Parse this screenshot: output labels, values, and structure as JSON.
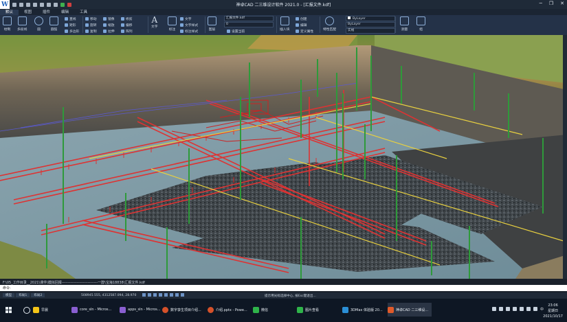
{
  "app": {
    "title": "神卓CAD 二三维设计软件 2021.0 - [汇报文件.kdf]",
    "logo_letter": "W"
  },
  "window_controls": {
    "minimize": "─",
    "maximize": "❐",
    "close": "✕"
  },
  "tabs": [
    "默认",
    "视图",
    "插件",
    "编辑",
    "工具"
  ],
  "active_tab": 0,
  "ribbon": {
    "draw_big": [
      "绘制",
      "多段线",
      "圆",
      "圆弧"
    ],
    "draw_small": [
      "直线",
      "矩形",
      "多边形"
    ],
    "modify": [
      "移动",
      "旋转",
      "复制",
      "镜像",
      "缩放",
      "拉伸",
      "修剪",
      "偏移",
      "阵列"
    ],
    "text_big": "文字",
    "text_big2": "标注",
    "text_small": [
      "文字",
      "文字样式",
      "标注样式"
    ],
    "layer_big": "图层",
    "layer_dropdown": "汇报文件.kdf",
    "layer_dropdown2": "0",
    "layer_set": "设置当前",
    "block_big": "插入块",
    "block_small": [
      "创建",
      "编辑",
      "定义属性"
    ],
    "prop_big": "特性匹配",
    "bylayer1": "ByLayer",
    "bylayer2": "ByLayer",
    "bylayer3": "实线",
    "measure": "测量",
    "group": "组"
  },
  "command": {
    "history": "F:\\05_工作目录__2021\\课件\\模拟回报-----------------------------一醇\\宝海18838\\汇报文件.kdf",
    "prompt": "命令:"
  },
  "status": {
    "tabs": [
      "模型",
      "布局1",
      "布局2"
    ],
    "coords": "508945.555, 4312587.094, 28.970",
    "hint": "提示用光标选择中心, 按Esc键退出..."
  },
  "taskbar": {
    "items": [
      {
        "label": "早晨",
        "color": "#f5c518"
      },
      {
        "label": "core_sln - Micros...",
        "color": "#8a5fd1"
      },
      {
        "label": "apps_sln - Micros...",
        "color": "#8a5fd1"
      },
      {
        "label": "数字孪生项目介绍...",
        "color": "#d5512a"
      },
      {
        "label": "介绍.pptx - Powe...",
        "color": "#d5512a"
      },
      {
        "label": "微信",
        "color": "#2fb44a"
      },
      {
        "label": "图片查看",
        "color": "#2fb44a"
      },
      {
        "label": "3DMax 体验版 20...",
        "color": "#2b8fd6"
      },
      {
        "label": "神卓CAD 二三维设...",
        "color": "#e05a2a"
      }
    ],
    "time": "23:06",
    "weekday": "星期日",
    "date": "2021/10/17",
    "ime": "中"
  }
}
